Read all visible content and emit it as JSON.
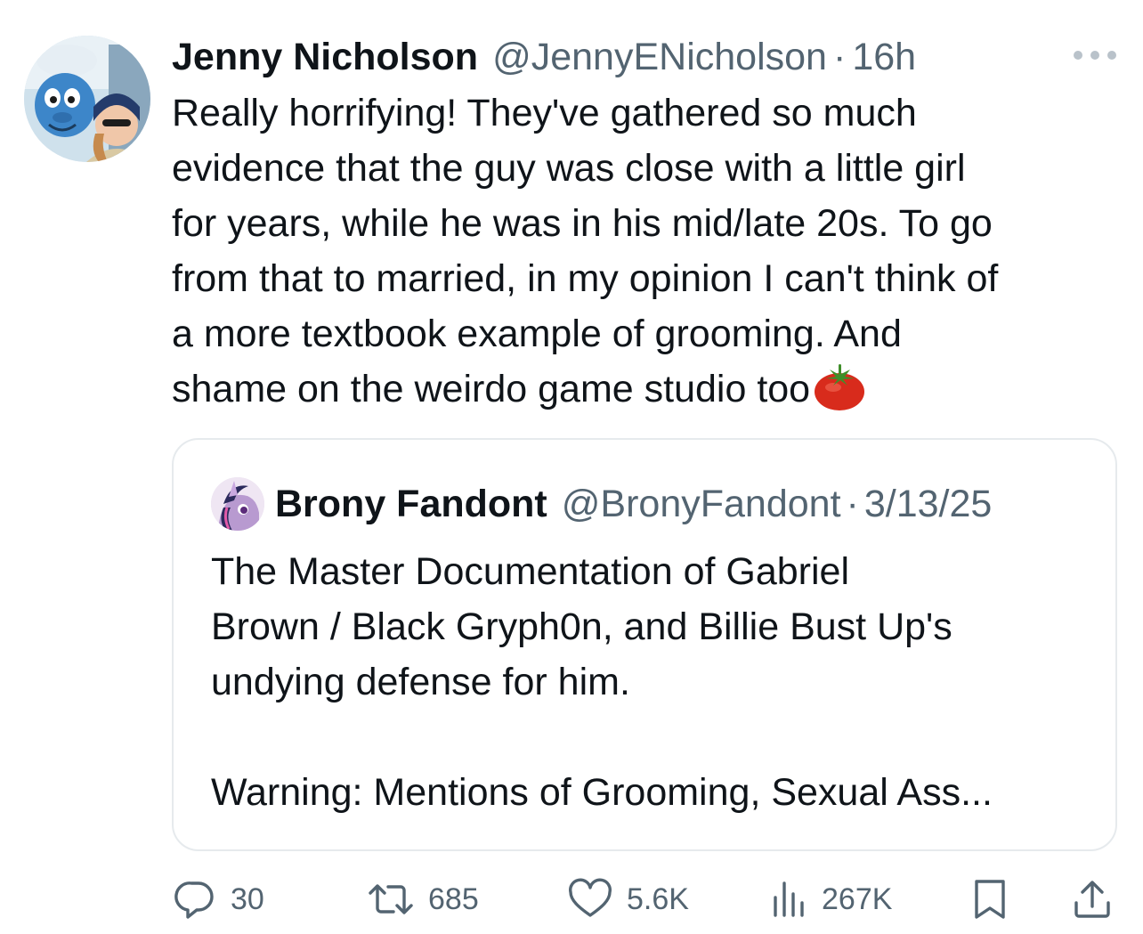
{
  "tweet": {
    "author_name": "Jenny Nicholson",
    "author_handle": "@JennyENicholson",
    "separator": "·",
    "time": "16h",
    "text_lines": [
      "Really horrifying! They've gathered so much",
      "evidence that the guy was close with a little girl",
      "for years, while he was in his mid/late 20s. To go",
      "from that to married, in my opinion I can't think of",
      "a more textbook example of grooming. And",
      "shame on the weirdo game studio too"
    ],
    "emoji": "tomato-emoji"
  },
  "quote": {
    "author_name": "Brony Fandont",
    "author_handle": "@BronyFandont",
    "separator": "·",
    "date": "3/13/25",
    "text_lines": [
      "The Master Documentation of Gabriel",
      "Brown / Black Gryph0n, and Billie Bust Up's",
      "undying defense for him.",
      "Warning: Mentions of Grooming, Sexual Ass..."
    ]
  },
  "actions": {
    "replies": "30",
    "reposts": "685",
    "likes": "5.6K",
    "views": "267K",
    "icons": [
      "reply-icon",
      "repost-icon",
      "like-icon",
      "views-icon",
      "bookmark-icon",
      "share-icon"
    ]
  },
  "colors": {
    "text": "#0f1419",
    "secondary": "#536471",
    "border": "#e6eaed"
  }
}
